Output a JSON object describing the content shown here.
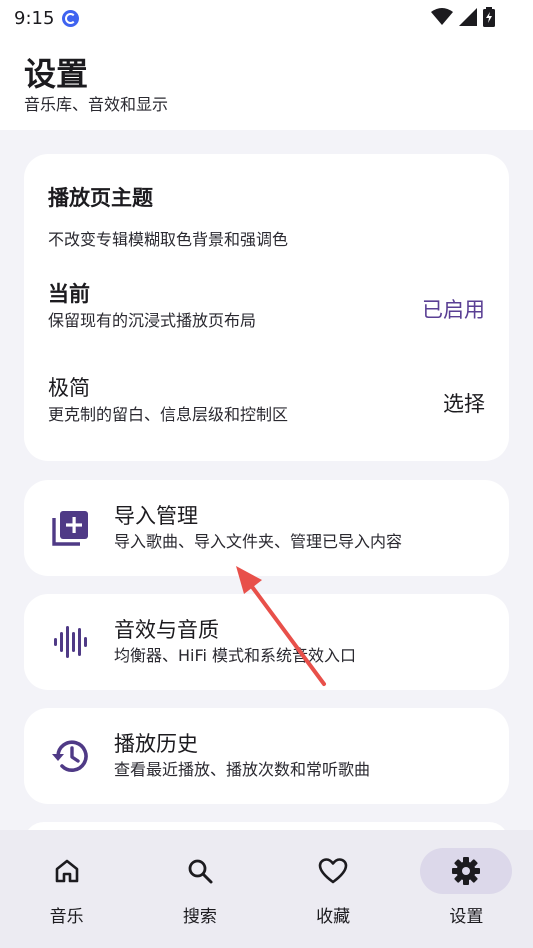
{
  "status_bar": {
    "time": "9:15"
  },
  "header": {
    "title": "设置",
    "subtitle": "音乐库、音效和显示"
  },
  "theme_card": {
    "title": "播放页主题",
    "description": "不改变专辑模糊取色背景和强调色",
    "options": [
      {
        "title": "当前",
        "description": "保留现有的沉浸式播放页布局",
        "action": "已启用"
      },
      {
        "title": "极简",
        "description": "更克制的留白、信息层级和控制区",
        "action": "选择"
      }
    ]
  },
  "settings_items": [
    {
      "icon": "playlist-add-icon",
      "title": "导入管理",
      "description": "导入歌曲、导入文件夹、管理已导入内容"
    },
    {
      "icon": "waveform-icon",
      "title": "音效与音质",
      "description": "均衡器、HiFi 模式和系统音效入口"
    },
    {
      "icon": "history-icon",
      "title": "播放历史",
      "description": "查看最近播放、播放次数和常听歌曲"
    }
  ],
  "bottom_nav": {
    "tabs": [
      {
        "label": "音乐",
        "icon": "home-icon",
        "active": false
      },
      {
        "label": "搜索",
        "icon": "search-icon",
        "active": false
      },
      {
        "label": "收藏",
        "icon": "heart-icon",
        "active": false
      },
      {
        "label": "设置",
        "icon": "gear-icon",
        "active": true
      }
    ]
  },
  "colors": {
    "accent": "#5a3f94",
    "icon": "#4f3a86",
    "annotation": "#e8504a"
  }
}
